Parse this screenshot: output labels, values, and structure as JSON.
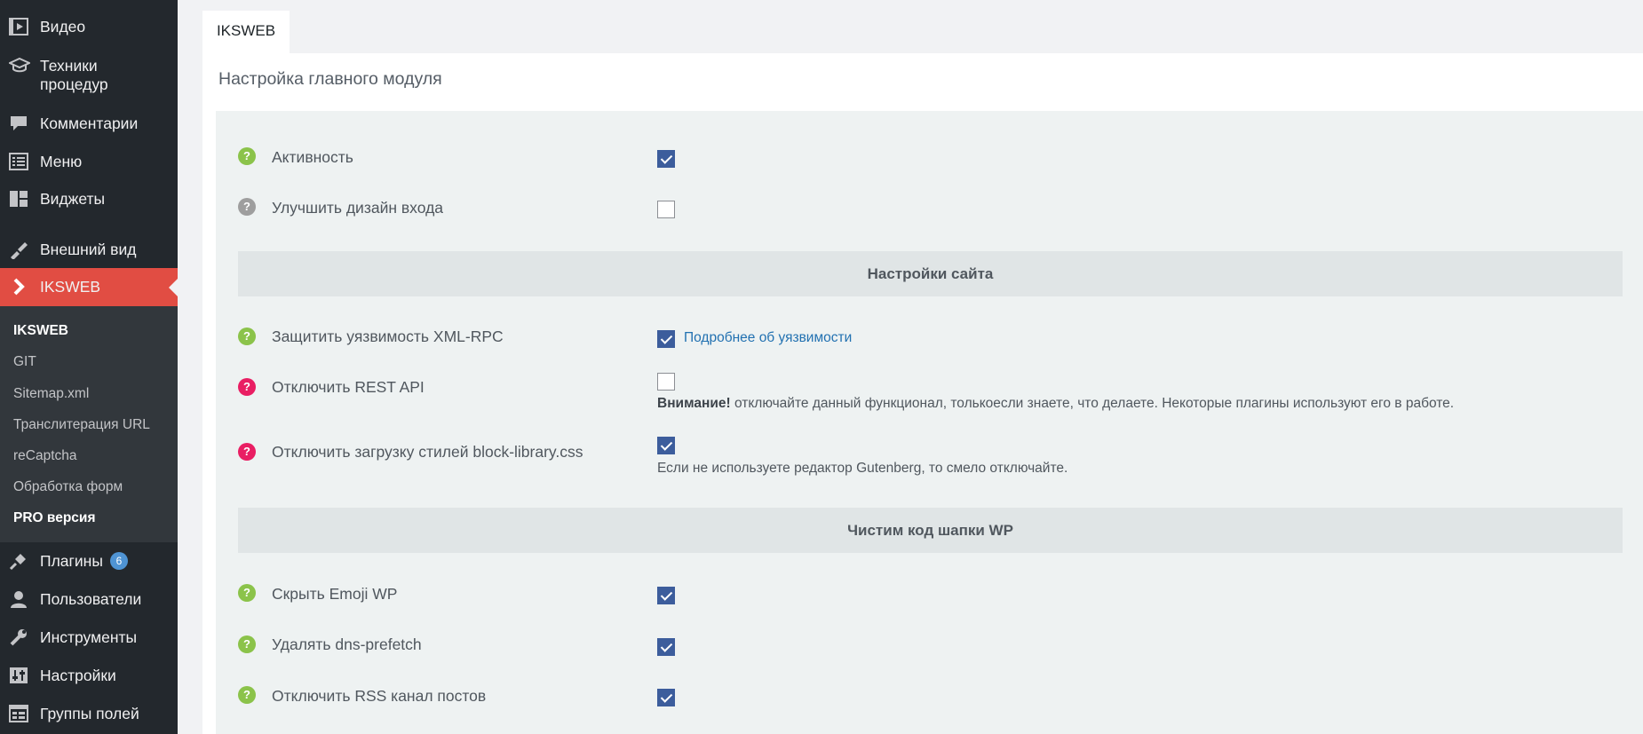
{
  "sidebar": {
    "items": [
      {
        "label": "Видео",
        "icon": "video-icon"
      },
      {
        "label_line1": "Техники",
        "label_line2": "процедур",
        "icon": "graduation-cap-icon"
      },
      {
        "label": "Комментарии",
        "icon": "comment-icon"
      },
      {
        "label": "Меню",
        "icon": "menu-list-icon"
      },
      {
        "label": "Виджеты",
        "icon": "widgets-icon"
      },
      {
        "label": "Внешний вид",
        "icon": "appearance-icon"
      },
      {
        "label": "IKSWEB",
        "icon": "chevron-right-icon"
      },
      {
        "label": "Плагины",
        "icon": "plugins-icon",
        "badge": "6"
      },
      {
        "label": "Пользователи",
        "icon": "users-icon"
      },
      {
        "label": "Инструменты",
        "icon": "tools-icon"
      },
      {
        "label": "Настройки",
        "icon": "settings-icon"
      },
      {
        "label": "Группы полей",
        "icon": "field-groups-icon"
      }
    ],
    "submenu": [
      "IKSWEB",
      "GIT",
      "Sitemap.xml",
      "Транслитерация URL",
      "reCaptcha",
      "Обработка форм",
      "PRO версия"
    ],
    "active_color": "#e14d43"
  },
  "tab": {
    "label": "IKSWEB"
  },
  "panel": {
    "title": "Настройка главного модуля"
  },
  "settings": {
    "activity": {
      "label": "Активность",
      "checked": true
    },
    "login_design": {
      "label": "Улучшить дизайн входа",
      "checked": false
    },
    "site_section": "Настройки сайта",
    "xmlrpc": {
      "label": "Защитить уязвимость XML-RPC",
      "checked": true,
      "link": "Подробнее об уязвимости"
    },
    "rest_api": {
      "label": "Отключить REST API",
      "checked": false,
      "note_bold": "Внимание!",
      "note": " отключайте данный функционал, толькоесли знаете, что делаете. Некоторые плагины используют его в работе."
    },
    "block_library": {
      "label": "Отключить загрузку стилей block-library.css",
      "checked": true,
      "note": "Если не используете редактор Gutenberg, то смело отключайте."
    },
    "header_section": "Чистим код шапки WP",
    "emoji": {
      "label": "Скрыть Emoji WP",
      "checked": true
    },
    "dns_prefetch": {
      "label": "Удалять dns-prefetch",
      "checked": true
    },
    "rss": {
      "label": "Отключить RSS канал постов",
      "checked": true
    }
  }
}
